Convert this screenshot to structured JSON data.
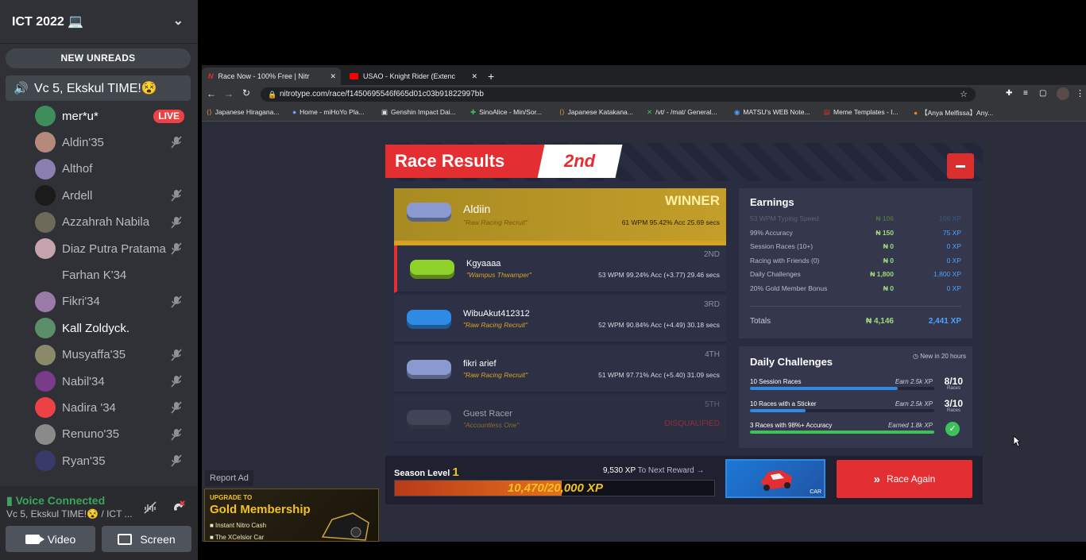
{
  "discord": {
    "server_name": "ICT 2022 💻",
    "new_unreads": "NEW UNREADS",
    "voice_channel": "Vc 5, Ekskul TIME!😵",
    "live_badge": "LIVE",
    "members": [
      {
        "name": "mer*u*",
        "muted": false,
        "live": true,
        "color": "#3e8d5a"
      },
      {
        "name": "Aldin'35",
        "muted": true,
        "color": "#b58a7a"
      },
      {
        "name": "Althof",
        "muted": false,
        "color": "#8b7fb0"
      },
      {
        "name": "Ardell",
        "muted": true,
        "color": "#1b1b1b"
      },
      {
        "name": "Azzahrah Nabila",
        "muted": true,
        "color": "#6d6a5a"
      },
      {
        "name": "Diaz Putra Pratama",
        "muted": true,
        "color": "#c7a3b0"
      },
      {
        "name": "Farhan K'34",
        "muted": false,
        "color": "#2f3136"
      },
      {
        "name": "Fikri'34",
        "muted": true,
        "color": "#9b7aa8"
      },
      {
        "name": "Kall Zoldyck.",
        "muted": false,
        "color": "#5a8f6a"
      },
      {
        "name": "Musyaffa'35",
        "muted": true,
        "color": "#8a8a6a"
      },
      {
        "name": "Nabil'34",
        "muted": true,
        "color": "#7a3b8a"
      },
      {
        "name": "Nadira '34",
        "muted": true,
        "color": "#ed4245"
      },
      {
        "name": "Renuno'35",
        "muted": true,
        "color": "#8a8a8a"
      },
      {
        "name": "Ryan'35",
        "muted": true,
        "color": "#3a3a6a"
      }
    ],
    "voice_connected": "Voice Connected",
    "voice_sub": "Vc 5, Ekskul TIME!😵 / ICT ...",
    "video_label": "Video",
    "screen_label": "Screen"
  },
  "browser": {
    "tabs": [
      {
        "title": "Race Now - 100% Free | Nitr",
        "icon": "nitrotype-icon"
      },
      {
        "title": "USAO - Knight Rider (Extenc",
        "icon": "youtube-icon"
      }
    ],
    "url": "nitrotype.com/race/f1450695546f665d01c03b91822997bb",
    "bookmarks": [
      "Japanese Hiragana...",
      "Home - miHoYo Pla...",
      "Genshin Impact Dai...",
      "SinoAlice - Min/Sor...",
      "Japanese Katakana...",
      "/vt/ - /mat/ General...",
      "MATSU's WEB Note...",
      "Meme Templates - I...",
      "【Anya Melfissa】Any..."
    ]
  },
  "race": {
    "title": "Race Results",
    "place": "2nd",
    "racers": [
      {
        "name": "Aldiin",
        "title": "\"Raw Racing Recruit\"",
        "place": "WINNER",
        "stats": "61 WPM   95.42% Acc   25.69 secs",
        "car": "#8a9ad0"
      },
      {
        "name": "Kgyaaaa",
        "title": "\"Wampus Thwamper\"",
        "place": "2ND",
        "stats": "53 WPM   99.24% Acc   (+3.77) 29.46 secs",
        "car": "#8ed12a"
      },
      {
        "name": "WibuAkut412312",
        "title": "\"Raw Racing Recruit\"",
        "place": "3RD",
        "stats": "52 WPM   90.84% Acc   (+4.49) 30.18 secs",
        "car": "#2f8ae6"
      },
      {
        "name": "fikri arief",
        "title": "\"Raw Racing Recruit\"",
        "place": "4TH",
        "stats": "51 WPM   97.71% Acc   (+5.40) 31.09 secs",
        "car": "#8a9ad0"
      },
      {
        "name": "Guest Racer",
        "title": "\"Accountless One\"",
        "place": "5TH",
        "stats": "DISQUALIFIED",
        "car": "#55586a"
      }
    ],
    "earnings": {
      "title": "Earnings",
      "rows": [
        {
          "label": "53 WPM Typing Speed",
          "nitro": "106",
          "xp": "106 XP",
          "dim": true
        },
        {
          "label": "99% Accuracy",
          "nitro": "150",
          "xp": "75 XP",
          "dim": false
        },
        {
          "label": "Session Races (10+)",
          "nitro": "0",
          "xp": "0 XP",
          "dim": false
        },
        {
          "label": "Racing with Friends (0)",
          "nitro": "0",
          "xp": "0 XP",
          "dim": false
        },
        {
          "label": "Daily Challenges",
          "nitro": "1,800",
          "xp": "1,800 XP",
          "dim": false
        },
        {
          "label": "20% Gold Member Bonus",
          "nitro": "0",
          "xp": "0 XP",
          "dim": false
        }
      ],
      "totals_label": "Totals",
      "totals_nitro": "4,146",
      "totals_xp": "2,441 XP"
    },
    "daily": {
      "title": "Daily Challenges",
      "new_in": "New in 20 hours",
      "challenges": [
        {
          "label": "10 Session Races",
          "reward": "Earn 2.5k XP",
          "count": "8/10",
          "sub": "Races",
          "progress": 0.8,
          "color": "#2f8ae6",
          "done": false
        },
        {
          "label": "10 Races with a Sticker",
          "reward": "Earn 2.5k XP",
          "count": "3/10",
          "sub": "Races",
          "progress": 0.3,
          "color": "#2f8ae6",
          "done": false
        },
        {
          "label": "3 Races with 98%+ Accuracy",
          "reward": "Earned 1.8k XP",
          "count": "",
          "sub": "",
          "progress": 1.0,
          "color": "#3ec15a",
          "done": true
        }
      ]
    },
    "season": {
      "label": "Season Level",
      "level": "1",
      "to_next_xp": "9,530 XP",
      "to_next_text": "To Next Reward →",
      "xp_text": "10,470/20,000 XP",
      "xp_progress": 0.5235
    },
    "reward_label": "CAR",
    "race_again": "Race Again"
  },
  "ad": {
    "report": "Report Ad",
    "upgrade": "UPGRADE TO",
    "gold": "Gold Membership",
    "line1": "■ Instant Nitro Cash",
    "line2": "■ The XCelsior Car"
  }
}
